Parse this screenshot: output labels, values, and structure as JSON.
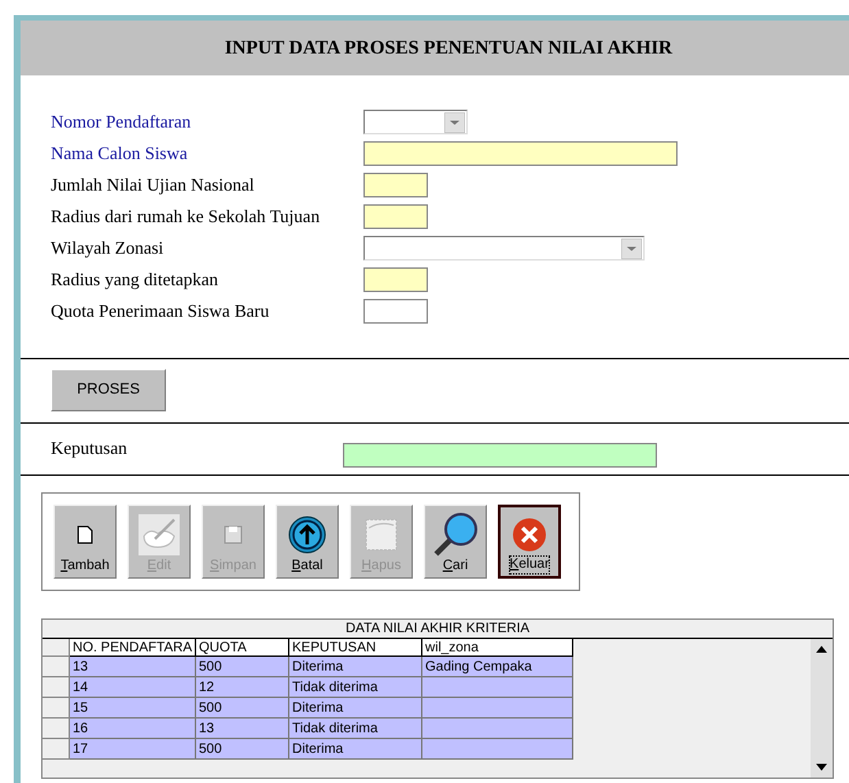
{
  "title": "INPUT DATA PROSES PENENTUAN NILAI AKHIR",
  "fields": [
    {
      "label": "Nomor Pendaftaran",
      "emphasized": true,
      "kind": "dropdown",
      "highlighted": false
    },
    {
      "label": "Nama Calon Siswa",
      "emphasized": true,
      "kind": "text",
      "highlighted": true
    },
    {
      "label": "Jumlah Nilai Ujian Nasional",
      "emphasized": false,
      "kind": "text",
      "highlighted": true
    },
    {
      "label": "Radius dari rumah ke Sekolah Tujuan",
      "emphasized": false,
      "kind": "text",
      "highlighted": true
    },
    {
      "label": "Wilayah Zonasi",
      "emphasized": false,
      "kind": "dropdown",
      "highlighted": false
    },
    {
      "label": "Radius yang ditetapkan",
      "emphasized": false,
      "kind": "text",
      "highlighted": true
    },
    {
      "label": "Quota Penerimaan Siswa Baru",
      "emphasized": false,
      "kind": "text",
      "highlighted": false
    }
  ],
  "process_button": "PROSES",
  "decision": {
    "label": "Keputusan"
  },
  "toolbar": [
    {
      "label": "Tambah",
      "disabled": false,
      "focused": false
    },
    {
      "label": "Edit",
      "disabled": true,
      "focused": false
    },
    {
      "label": "Simpan",
      "disabled": true,
      "focused": false
    },
    {
      "label": "Batal",
      "disabled": false,
      "focused": false
    },
    {
      "label": "Hapus",
      "disabled": true,
      "focused": false
    },
    {
      "label": "Cari",
      "disabled": false,
      "focused": false
    },
    {
      "label": "Keluar",
      "disabled": false,
      "focused": true
    }
  ],
  "table": {
    "title": "DATA NILAI AKHIR KRITERIA",
    "columns": [
      "NO. PENDAFTARA",
      "QUOTA",
      "KEPUTUSAN",
      "wil_zona"
    ],
    "rows": [
      [
        "13",
        "500",
        "Diterima",
        "Gading Cempaka"
      ],
      [
        "14",
        "12",
        "Tidak diterima",
        ""
      ],
      [
        "15",
        "500",
        "Diterima",
        ""
      ],
      [
        "16",
        "13",
        "Tidak diterima",
        ""
      ],
      [
        "17",
        "500",
        "Diterima",
        ""
      ]
    ]
  }
}
